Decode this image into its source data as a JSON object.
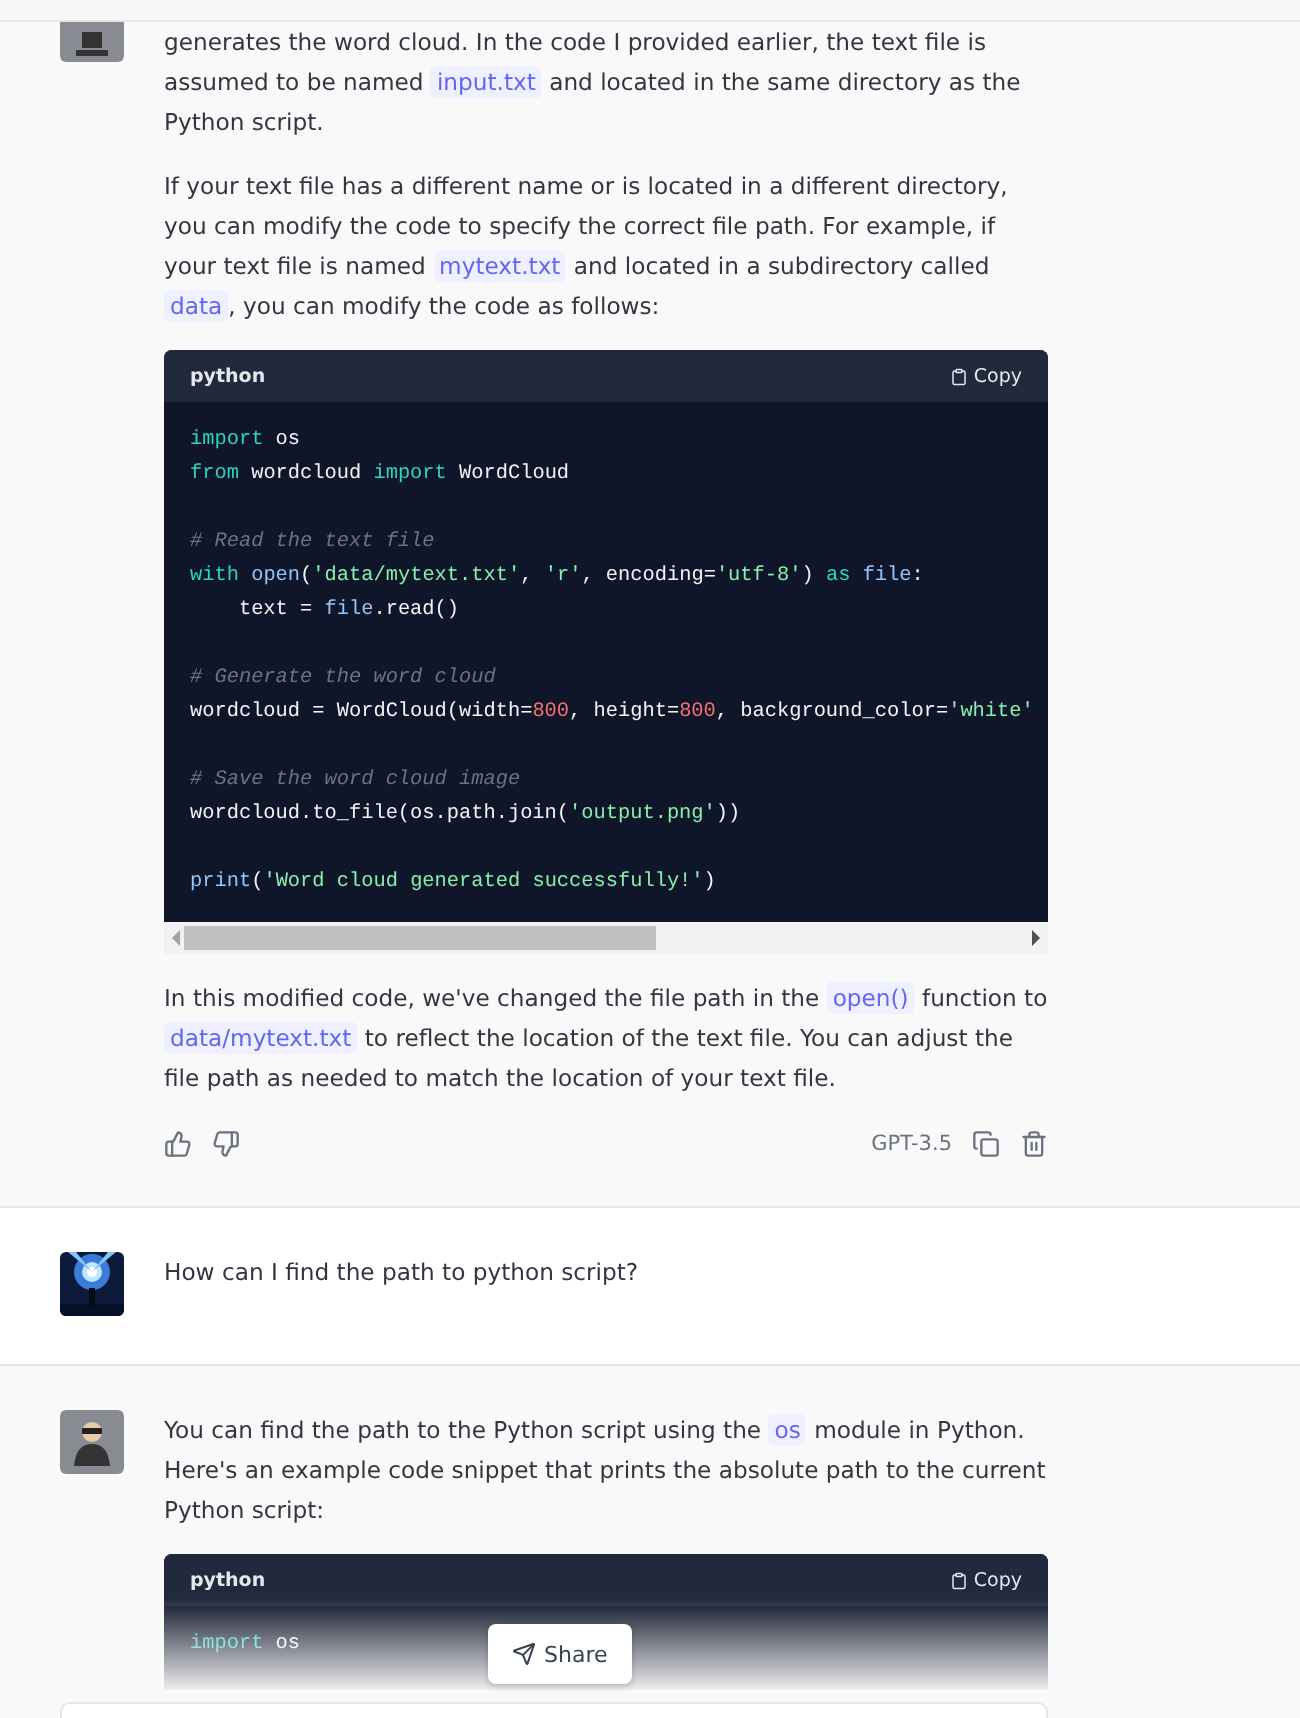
{
  "messages": [
    {
      "kind": "assistant",
      "avatar": {
        "kind": "laptop"
      },
      "blocks": [
        {
          "kind": "paragraph",
          "parts": [
            {
              "text": "generates the word cloud. In the code I provided earlier, the text file is assumed to be named ",
              "code": false
            },
            {
              "text": "input.txt",
              "code": true
            },
            {
              "text": " and located in the same directory as the Python script.",
              "code": false
            }
          ]
        },
        {
          "kind": "paragraph",
          "parts": [
            {
              "text": "If your text file has a different name or is located in a different directory, you can modify the code to specify the correct file path. For example, if your text file is named ",
              "code": false
            },
            {
              "text": "mytext.txt",
              "code": true
            },
            {
              "text": " and located in a subdirectory called ",
              "code": false
            },
            {
              "text": "data",
              "code": true
            },
            {
              "text": ", you can modify the code as follows:",
              "code": false
            }
          ]
        },
        {
          "kind": "code",
          "language": "python",
          "copy": "Copy",
          "faded": false,
          "scrollbar": true,
          "sections": [
            [
              [
                {
                  "t": "import",
                  "kind": "keyword"
                },
                {
                  "t": " os",
                  "kind": "plain"
                }
              ],
              [
                {
                  "t": "from",
                  "kind": "keyword"
                },
                {
                  "t": " wordcloud ",
                  "kind": "plain"
                },
                {
                  "t": "import",
                  "kind": "keyword"
                },
                {
                  "t": " WordCloud",
                  "kind": "plain"
                }
              ]
            ],
            [
              [
                {
                  "t": "# Read the text file",
                  "kind": "comment"
                }
              ],
              [
                {
                  "t": "with",
                  "kind": "keyword"
                },
                {
                  "t": " open",
                  "kind": "builtin"
                },
                {
                  "t": "(",
                  "kind": "plain"
                },
                {
                  "t": "'data/mytext.txt'",
                  "kind": "string"
                },
                {
                  "t": ", ",
                  "kind": "plain"
                },
                {
                  "t": "'r'",
                  "kind": "string"
                },
                {
                  "t": ", encoding=",
                  "kind": "plain"
                },
                {
                  "t": "'utf-8'",
                  "kind": "string"
                },
                {
                  "t": ") ",
                  "kind": "plain"
                },
                {
                  "t": "as",
                  "kind": "keyword"
                },
                {
                  "t": " file",
                  "kind": "builtin"
                },
                {
                  "t": ":",
                  "kind": "plain"
                }
              ],
              [
                {
                  "t": "    text = ",
                  "kind": "plain"
                },
                {
                  "t": "file",
                  "kind": "builtin"
                },
                {
                  "t": ".read()",
                  "kind": "plain"
                }
              ]
            ],
            [
              [
                {
                  "t": "# Generate the word cloud",
                  "kind": "comment"
                }
              ],
              [
                {
                  "t": "wordcloud = WordCloud(width=",
                  "kind": "plain"
                },
                {
                  "t": "800",
                  "kind": "number"
                },
                {
                  "t": ", height=",
                  "kind": "plain"
                },
                {
                  "t": "800",
                  "kind": "number"
                },
                {
                  "t": ", background_color=",
                  "kind": "plain"
                },
                {
                  "t": "'white'",
                  "kind": "string"
                }
              ]
            ],
            [
              [
                {
                  "t": "# Save the word cloud image",
                  "kind": "comment"
                }
              ],
              [
                {
                  "t": "wordcloud.to_file(os.path.join(",
                  "kind": "plain"
                },
                {
                  "t": "'output.png'",
                  "kind": "string"
                },
                {
                  "t": "))",
                  "kind": "plain"
                }
              ]
            ],
            [
              [
                {
                  "t": "print",
                  "kind": "builtin"
                },
                {
                  "t": "(",
                  "kind": "plain"
                },
                {
                  "t": "'Word cloud generated successfully!'",
                  "kind": "string"
                },
                {
                  "t": ")",
                  "kind": "plain"
                }
              ]
            ]
          ]
        },
        {
          "kind": "paragraph",
          "parts": [
            {
              "text": "In this modified code, we've changed the file path in the ",
              "code": false
            },
            {
              "text": "open()",
              "code": true
            },
            {
              "text": " function to ",
              "code": false
            },
            {
              "text": "data/mytext.txt",
              "code": true
            },
            {
              "text": " to reflect the location of the text file. You can adjust the file path as needed to match the location of your text file.",
              "code": false
            }
          ]
        },
        {
          "kind": "actions",
          "model": "GPT-3.5"
        }
      ]
    },
    {
      "kind": "user",
      "avatar": {
        "kind": "picture"
      },
      "blocks": [
        {
          "kind": "paragraph",
          "parts": [
            {
              "text": "How can I find the path to python script?",
              "code": false
            }
          ]
        }
      ]
    },
    {
      "kind": "assistant",
      "avatar": {
        "kind": "figure"
      },
      "blocks": [
        {
          "kind": "paragraph",
          "parts": [
            {
              "text": "You can find the path to the Python script using the ",
              "code": false
            },
            {
              "text": "os",
              "code": true
            },
            {
              "text": " module in Python. Here's an example code snippet that prints the absolute path to the current Python script:",
              "code": false
            }
          ]
        },
        {
          "kind": "code",
          "language": "python",
          "copy": "Copy",
          "faded": true,
          "scrollbar": false,
          "sections": [
            [
              [
                {
                  "t": "import",
                  "kind": "keyword"
                },
                {
                  "t": " os",
                  "kind": "plain"
                }
              ]
            ]
          ]
        }
      ]
    }
  ],
  "share_button": "Share"
}
